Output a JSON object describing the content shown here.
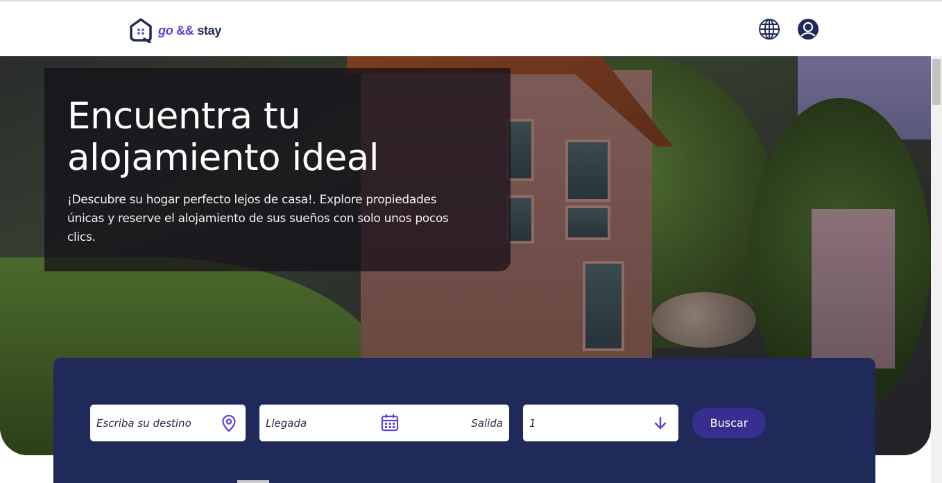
{
  "header": {
    "logo": {
      "go": "go",
      "amp": "&&",
      "stay": "stay"
    },
    "icons": {
      "language": "globe-icon",
      "account": "user-circle-icon"
    }
  },
  "hero": {
    "title": "Encuentra tu alojamiento ideal",
    "subtitle": "¡Descubre su hogar perfecto lejos de casa!. Explore propiedades únicas y reserve el alojamiento de sus sueños con solo unos pocos clics."
  },
  "search": {
    "destination_placeholder": "Escriba su destino",
    "arrival_placeholder": "Llegada",
    "departure_placeholder": "Salida",
    "guests_value": "1",
    "button_label": "Buscar",
    "icons": {
      "destination": "map-pin-icon",
      "dates": "calendar-icon",
      "guests": "arrow-down-icon"
    }
  },
  "colors": {
    "brand_purple": "#5b3fe0",
    "brand_navy": "#1f2a5a",
    "button": "#372e8f"
  }
}
